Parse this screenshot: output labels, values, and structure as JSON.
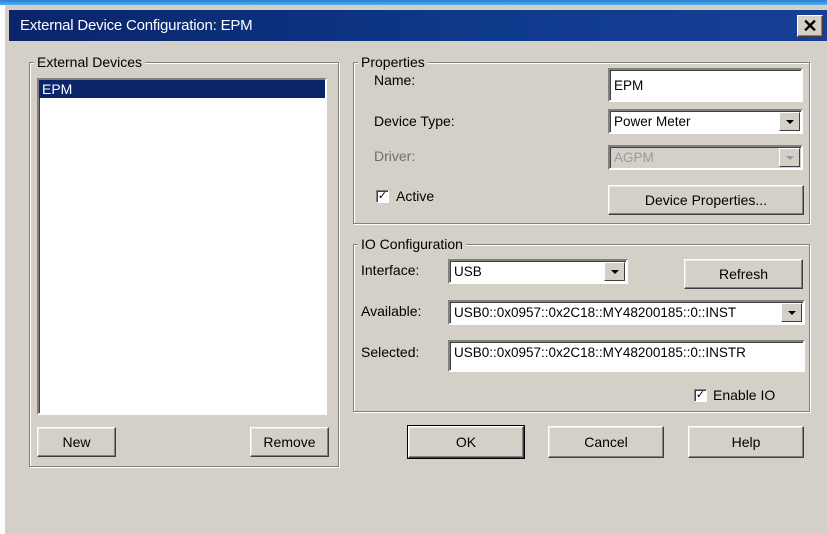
{
  "window": {
    "title": "External Device Configuration: EPM",
    "close_glyph": "✕"
  },
  "devices": {
    "group_label": "External Devices",
    "items": [
      {
        "label": "EPM",
        "selected": true
      }
    ],
    "new_label": "New",
    "remove_label": "Remove"
  },
  "properties": {
    "group_label": "Properties",
    "name_label": "Name:",
    "name_value": "EPM",
    "device_type_label": "Device Type:",
    "device_type_value": "Power Meter",
    "driver_label": "Driver:",
    "driver_value": "AGPM",
    "active_label": "Active",
    "active_checked": true,
    "device_properties_label": "Device Properties..."
  },
  "io": {
    "group_label": "IO Configuration",
    "interface_label": "Interface:",
    "interface_value": "USB",
    "refresh_label": "Refresh",
    "available_label": "Available:",
    "available_value": "USB0::0x0957::0x2C18::MY48200185::0::INST",
    "selected_label": "Selected:",
    "selected_value": "USB0::0x0957::0x2C18::MY48200185::0::INSTR",
    "enable_io_label": "Enable IO",
    "enable_io_checked": true
  },
  "footer": {
    "ok_label": "OK",
    "cancel_label": "Cancel",
    "help_label": "Help"
  },
  "check_glyph": "✓"
}
